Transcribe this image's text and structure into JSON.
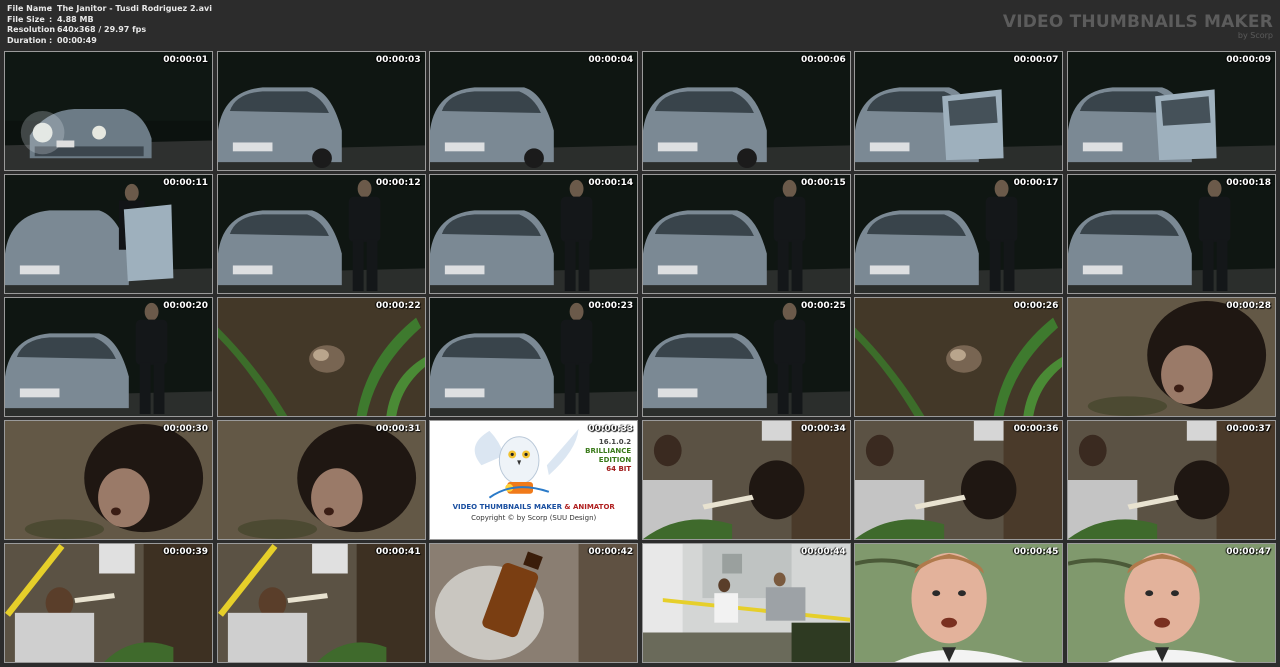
{
  "header": {
    "rows": [
      {
        "label": "File Name",
        "value": "The Janitor - Tusdi Rodriguez 2.avi"
      },
      {
        "label": "File Size",
        "value": "4.88 MB"
      },
      {
        "label": "Resolution",
        "value": "640x368 / 29.97 fps"
      },
      {
        "label": "Duration",
        "value": "00:00:49"
      }
    ],
    "separator": ":"
  },
  "brand": {
    "title": "VIDEO THUMBNAILS MAKER",
    "subtitle": "by Scorp"
  },
  "splash": {
    "version": "16.1.0.2",
    "edition_line1": "BRILLIANCE",
    "edition_line2": "EDITION",
    "bits": "64 BIT",
    "name_part1": "VIDEO THUMBNAILS MAKER",
    "name_part2": "& ANIMATOR",
    "copyright": "Copyright © by Scorp (SUU Design)"
  },
  "thumbnails": [
    {
      "time": "00:00:01",
      "scene": "car-night-headlights"
    },
    {
      "time": "00:00:03",
      "scene": "car-night"
    },
    {
      "time": "00:00:04",
      "scene": "car-night"
    },
    {
      "time": "00:00:06",
      "scene": "car-night"
    },
    {
      "time": "00:00:07",
      "scene": "car-door-open"
    },
    {
      "time": "00:00:09",
      "scene": "car-door-open"
    },
    {
      "time": "00:00:11",
      "scene": "man-at-car-door"
    },
    {
      "time": "00:00:12",
      "scene": "man-beside-car"
    },
    {
      "time": "00:00:14",
      "scene": "man-beside-car"
    },
    {
      "time": "00:00:15",
      "scene": "man-beside-car"
    },
    {
      "time": "00:00:17",
      "scene": "man-beside-car"
    },
    {
      "time": "00:00:18",
      "scene": "man-beside-car"
    },
    {
      "time": "00:00:20",
      "scene": "man-beside-car"
    },
    {
      "time": "00:00:22",
      "scene": "ground-plants"
    },
    {
      "time": "00:00:23",
      "scene": "man-beside-car"
    },
    {
      "time": "00:00:25",
      "scene": "man-beside-car"
    },
    {
      "time": "00:00:26",
      "scene": "ground-plants"
    },
    {
      "time": "00:00:28",
      "scene": "curly-hair-closeup"
    },
    {
      "time": "00:00:30",
      "scene": "curly-hair-closeup"
    },
    {
      "time": "00:00:31",
      "scene": "curly-hair-closeup"
    },
    {
      "time": "00:00:33",
      "scene": "splash"
    },
    {
      "time": "00:00:34",
      "scene": "crime-scene"
    },
    {
      "time": "00:00:36",
      "scene": "crime-scene"
    },
    {
      "time": "00:00:37",
      "scene": "crime-scene"
    },
    {
      "time": "00:00:39",
      "scene": "crime-scene-tape"
    },
    {
      "time": "00:00:41",
      "scene": "crime-scene-tape"
    },
    {
      "time": "00:00:42",
      "scene": "bottle-closeup"
    },
    {
      "time": "00:00:44",
      "scene": "building-tape"
    },
    {
      "time": "00:00:45",
      "scene": "face-closeup"
    },
    {
      "time": "00:00:47",
      "scene": "face-closeup"
    }
  ],
  "colors": {
    "background": "#2c2c2c",
    "text": "#e8e8e8",
    "brand": "#5c5c5c",
    "thumb_border": "#9a9a9a"
  }
}
